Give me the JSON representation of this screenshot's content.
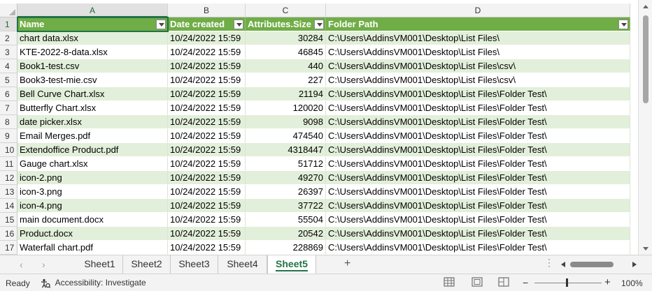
{
  "columns": [
    {
      "letter": "A",
      "header": "Name"
    },
    {
      "letter": "B",
      "header": "Date created"
    },
    {
      "letter": "C",
      "header": "Attributes.Size"
    },
    {
      "letter": "D",
      "header": "Folder Path"
    }
  ],
  "rows": [
    {
      "num": "2",
      "name": "chart data.xlsx",
      "date": "10/24/2022 15:59",
      "size": "30284",
      "path": "C:\\Users\\AddinsVM001\\Desktop\\List Files\\"
    },
    {
      "num": "3",
      "name": "KTE-2022-8-data.xlsx",
      "date": "10/24/2022 15:59",
      "size": "46845",
      "path": "C:\\Users\\AddinsVM001\\Desktop\\List Files\\"
    },
    {
      "num": "4",
      "name": "Book1-test.csv",
      "date": "10/24/2022 15:59",
      "size": "440",
      "path": "C:\\Users\\AddinsVM001\\Desktop\\List Files\\csv\\"
    },
    {
      "num": "5",
      "name": "Book3-test-mie.csv",
      "date": "10/24/2022 15:59",
      "size": "227",
      "path": "C:\\Users\\AddinsVM001\\Desktop\\List Files\\csv\\"
    },
    {
      "num": "6",
      "name": "Bell Curve Chart.xlsx",
      "date": "10/24/2022 15:59",
      "size": "21194",
      "path": "C:\\Users\\AddinsVM001\\Desktop\\List Files\\Folder Test\\"
    },
    {
      "num": "7",
      "name": "Butterfly Chart.xlsx",
      "date": "10/24/2022 15:59",
      "size": "120020",
      "path": "C:\\Users\\AddinsVM001\\Desktop\\List Files\\Folder Test\\"
    },
    {
      "num": "8",
      "name": "date picker.xlsx",
      "date": "10/24/2022 15:59",
      "size": "9098",
      "path": "C:\\Users\\AddinsVM001\\Desktop\\List Files\\Folder Test\\"
    },
    {
      "num": "9",
      "name": "Email Merges.pdf",
      "date": "10/24/2022 15:59",
      "size": "474540",
      "path": "C:\\Users\\AddinsVM001\\Desktop\\List Files\\Folder Test\\"
    },
    {
      "num": "10",
      "name": "Extendoffice Product.pdf",
      "date": "10/24/2022 15:59",
      "size": "4318447",
      "path": "C:\\Users\\AddinsVM001\\Desktop\\List Files\\Folder Test\\"
    },
    {
      "num": "11",
      "name": "Gauge chart.xlsx",
      "date": "10/24/2022 15:59",
      "size": "51712",
      "path": "C:\\Users\\AddinsVM001\\Desktop\\List Files\\Folder Test\\"
    },
    {
      "num": "12",
      "name": "icon-2.png",
      "date": "10/24/2022 15:59",
      "size": "49270",
      "path": "C:\\Users\\AddinsVM001\\Desktop\\List Files\\Folder Test\\"
    },
    {
      "num": "13",
      "name": "icon-3.png",
      "date": "10/24/2022 15:59",
      "size": "26397",
      "path": "C:\\Users\\AddinsVM001\\Desktop\\List Files\\Folder Test\\"
    },
    {
      "num": "14",
      "name": "icon-4.png",
      "date": "10/24/2022 15:59",
      "size": "37722",
      "path": "C:\\Users\\AddinsVM001\\Desktop\\List Files\\Folder Test\\"
    },
    {
      "num": "15",
      "name": "main document.docx",
      "date": "10/24/2022 15:59",
      "size": "55504",
      "path": "C:\\Users\\AddinsVM001\\Desktop\\List Files\\Folder Test\\"
    },
    {
      "num": "16",
      "name": "Product.docx",
      "date": "10/24/2022 15:59",
      "size": "20542",
      "path": "C:\\Users\\AddinsVM001\\Desktop\\List Files\\Folder Test\\"
    },
    {
      "num": "17",
      "name": "Waterfall chart.pdf",
      "date": "10/24/2022 15:59",
      "size": "228869",
      "path": "C:\\Users\\AddinsVM001\\Desktop\\List Files\\Folder Test\\"
    }
  ],
  "header_row_num": "1",
  "sheets": [
    "Sheet1",
    "Sheet2",
    "Sheet3",
    "Sheet4",
    "Sheet5"
  ],
  "active_sheet": "Sheet5",
  "status": {
    "ready": "Ready",
    "accessibility": "Accessibility: Investigate",
    "zoom": "100%"
  },
  "colors": {
    "table_header": "#70ad47",
    "band": "#e2efda",
    "accent": "#217346"
  }
}
